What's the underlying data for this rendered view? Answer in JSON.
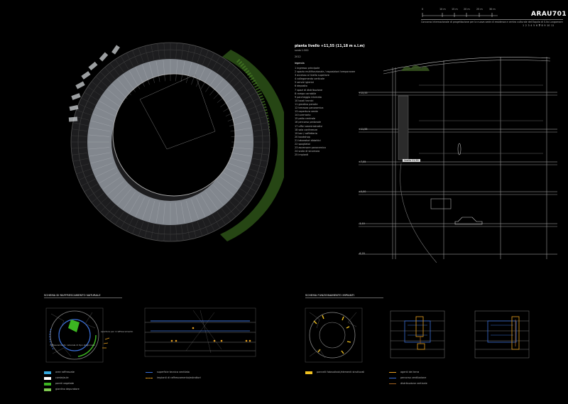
{
  "header": {
    "project_code": "ARAU701",
    "scale_ticks": [
      "0",
      "10 m",
      "15 m",
      "20 m",
      "25 m",
      "30 m"
    ],
    "subtitle": "Concorso internazionale di progettazione per la nuova sede di residenza e centro culturale dell'Aquila di S.Ilo Lungomare",
    "page_numbers": [
      "1",
      "2",
      "3",
      "4",
      "5",
      "6",
      "7",
      "8",
      "9",
      "10",
      "11"
    ],
    "current_page": "7"
  },
  "plan_info": {
    "title": "pianta livello +11,55 (11,18 m s.l.m)",
    "scale": "scala 1:500",
    "year": "2012",
    "legend_title": "legenda",
    "legend_items": [
      "1  ingresso principale",
      "2  spazio multifunzionale / esposizioni temporanee",
      "3  accesso al livello superiore",
      "4  collegamento verticale",
      "5  servizi igienici",
      "6  deposito",
      "7  spazi di distribuzione",
      "8  rampa carrabile",
      "9  parcheggio interrato",
      "10 locali tecnici",
      "11 giardino pensile",
      "12 terrazza panoramica",
      "13 copertura verde",
      "14 lucernario",
      "15 patio centrale",
      "16 percorso pedonale",
      "17 uffici amministrativi",
      "18 sala conferenze",
      "19 bar / caffetteria",
      "20 bookshop",
      "21 laboratori didattici",
      "22 spogliatoi",
      "23 ascensore panoramico",
      "24 scala di sicurezza",
      "25 impianti"
    ]
  },
  "section_levels": [
    "+15,55",
    "+11,55",
    "+7,55",
    "±0,00",
    "-3,10",
    "-6,20",
    "-9,30"
  ],
  "section_tag": "livello 11,55",
  "schemes": {
    "natural": {
      "title": "SCHEMA DI RAFFRESCAMENTO NATURALE",
      "plan_note_right": "apertura per il raffrescamento",
      "plan_note_left": "raffrescamento naturale di tipo stagionale",
      "legend": [
        {
          "label": "aree raffrescate",
          "color": "#35a9e0"
        },
        {
          "label": "corsie/aule",
          "color": "#ffffff"
        },
        {
          "label": "pareti vegetate",
          "color": "#3cb521"
        },
        {
          "label": "giardino depuratore",
          "color": "#7ec850"
        }
      ],
      "legend_mid": [
        {
          "label": "superficie tecnica ventilata",
          "color": "#3a6fd8"
        },
        {
          "label": "impianti di raffrescamento/estrattori",
          "color": "#e8a020"
        }
      ]
    },
    "plant": {
      "title": "SCHEMA FUNZIONAMENTO IMPIANTI",
      "legend_left": [
        {
          "label": "pannelli fotovoltaici/elementi strutturali",
          "color": "#f0c020"
        }
      ],
      "legend_right": [
        {
          "label": "agenti dei terra",
          "color": "#e8a020"
        },
        {
          "label": "percorso ventilazione",
          "color": "#3a6fd8"
        },
        {
          "label": "distribuzione verticale",
          "color": "#a06020"
        }
      ]
    }
  },
  "colors": {
    "accent_blue": "#3a6fd8",
    "accent_orange": "#e8a020",
    "accent_green": "#3cb521",
    "line_grey": "#8a8a8a"
  }
}
